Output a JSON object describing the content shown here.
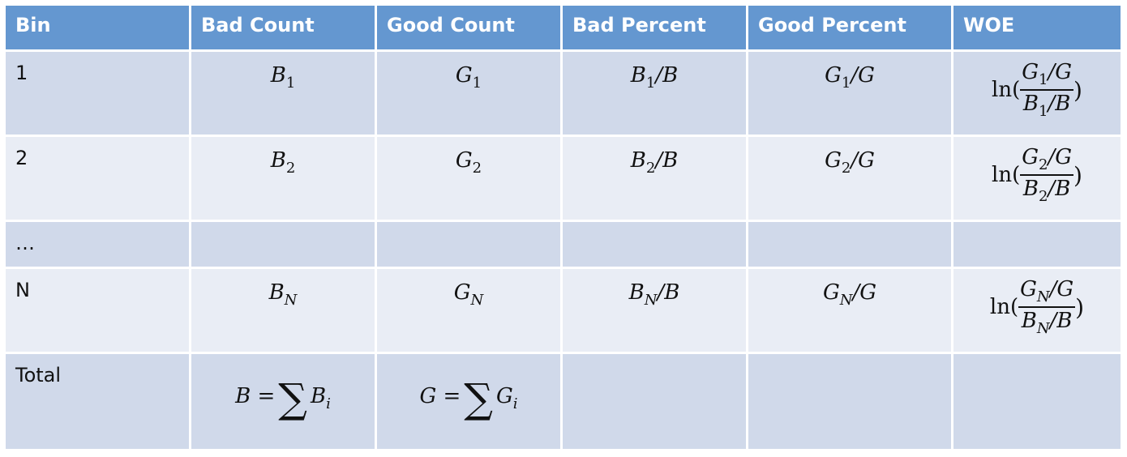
{
  "headers": [
    "Bin",
    "Bad Count",
    "Good Count",
    "Bad Percent",
    "Good Percent",
    "WOE"
  ],
  "colors": {
    "header": "#6497d0",
    "row_odd": "#d0d9ea",
    "row_even": "#e9edf5"
  },
  "rows": [
    {
      "bin": "1",
      "bad": {
        "v": "B",
        "s": "1"
      },
      "good": {
        "v": "G",
        "s": "1"
      },
      "bad_pct": {
        "v": "B",
        "s": "1",
        "d": "/B"
      },
      "good_pct": {
        "v": "G",
        "s": "1",
        "d": "/G"
      },
      "woe": {
        "fn": "ln(",
        "num": {
          "v": "G",
          "s": "1",
          "d": "/G"
        },
        "den": {
          "v": "B",
          "s": "1",
          "d": "/B"
        },
        "close": ")"
      }
    },
    {
      "bin": "2",
      "bad": {
        "v": "B",
        "s": "2"
      },
      "good": {
        "v": "G",
        "s": "2"
      },
      "bad_pct": {
        "v": "B",
        "s": "2",
        "d": "/B"
      },
      "good_pct": {
        "v": "G",
        "s": "2",
        "d": "/G"
      },
      "woe": {
        "fn": "ln(",
        "num": {
          "v": "G",
          "s": "2",
          "d": "/G"
        },
        "den": {
          "v": "B",
          "s": "2",
          "d": "/B"
        },
        "close": ")"
      }
    },
    {
      "bin": "…"
    },
    {
      "bin": "N",
      "bad": {
        "v": "B",
        "s": "N"
      },
      "good": {
        "v": "G",
        "s": "N"
      },
      "bad_pct": {
        "v": "B",
        "s": "N",
        "d": "/B"
      },
      "good_pct": {
        "v": "G",
        "s": "N",
        "d": "/G"
      },
      "woe": {
        "fn": "ln(",
        "num": {
          "v": "G",
          "s": "N",
          "d": "/G"
        },
        "den": {
          "v": "B",
          "s": "N",
          "d": "/B"
        },
        "close": ")"
      }
    }
  ],
  "total": {
    "label": "Total",
    "bad": {
      "lhs": "B",
      "eq": "=",
      "sigma": "∑",
      "v": "B",
      "s": "i"
    },
    "good": {
      "lhs": "G",
      "eq": "=",
      "sigma": "∑",
      "v": "G",
      "s": "i"
    }
  }
}
